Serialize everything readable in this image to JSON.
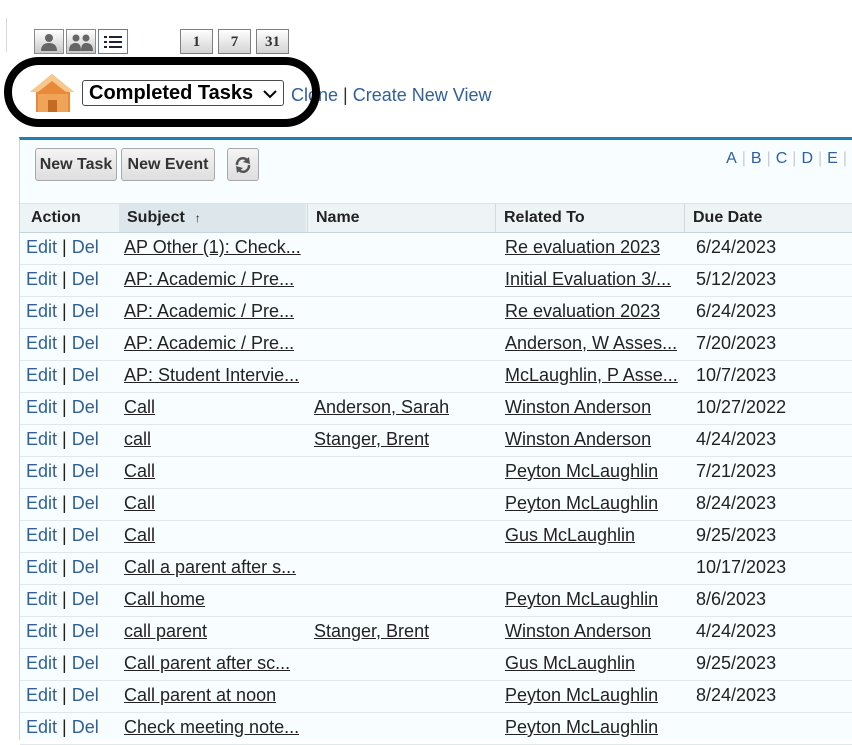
{
  "toolbar": {
    "calendar_buttons": [
      "1",
      "7",
      "31"
    ]
  },
  "view": {
    "selected": "Completed Tasks",
    "clone_label": "Clone",
    "separator": "|",
    "create_label": "Create New View"
  },
  "actions": {
    "new_task": "New Task",
    "new_event": "New Event"
  },
  "alphabet": [
    "A",
    "B",
    "C",
    "D",
    "E"
  ],
  "table": {
    "headers": {
      "action": "Action",
      "subject": "Subject",
      "sort_arrow": "↑",
      "name": "Name",
      "related": "Related To",
      "due": "Due Date"
    },
    "edit_label": "Edit",
    "del_label": "Del",
    "rows": [
      {
        "subject": "AP Other (1): Check...",
        "name": "",
        "related": "Re evaluation 2023",
        "due": "6/24/2023"
      },
      {
        "subject": "AP: Academic / Pre...",
        "name": "",
        "related": "Initial Evaluation 3/...",
        "due": "5/12/2023"
      },
      {
        "subject": "AP: Academic / Pre...",
        "name": "",
        "related": "Re evaluation 2023",
        "due": "6/24/2023"
      },
      {
        "subject": "AP: Academic / Pre...",
        "name": "",
        "related": "Anderson, W Asses...",
        "due": "7/20/2023"
      },
      {
        "subject": "AP: Student Intervie...",
        "name": "",
        "related": "McLaughlin, P Asse...",
        "due": "10/7/2023"
      },
      {
        "subject": "Call",
        "name": "Anderson, Sarah",
        "related": "Winston Anderson",
        "due": "10/27/2022"
      },
      {
        "subject": "call",
        "name": "Stanger, Brent",
        "related": "Winston Anderson",
        "due": "4/24/2023"
      },
      {
        "subject": "Call",
        "name": "",
        "related": "Peyton McLaughlin",
        "due": "7/21/2023"
      },
      {
        "subject": "Call",
        "name": "",
        "related": "Peyton McLaughlin",
        "due": "8/24/2023"
      },
      {
        "subject": "Call",
        "name": "",
        "related": "Gus McLaughlin",
        "due": "9/25/2023"
      },
      {
        "subject": "Call a parent after s...",
        "name": "",
        "related": "",
        "due": "10/17/2023"
      },
      {
        "subject": "Call home",
        "name": "",
        "related": "Peyton McLaughlin",
        "due": "8/6/2023"
      },
      {
        "subject": "call parent",
        "name": "Stanger, Brent",
        "related": "Winston Anderson",
        "due": "4/24/2023"
      },
      {
        "subject": "Call parent after sc...",
        "name": "",
        "related": "Gus McLaughlin",
        "due": "9/25/2023"
      },
      {
        "subject": "Call parent at noon",
        "name": "",
        "related": "Peyton McLaughlin",
        "due": "8/24/2023"
      },
      {
        "subject": "Check meeting note...",
        "name": "",
        "related": "Peyton McLaughlin",
        "due": ""
      }
    ]
  },
  "colors": {
    "link": "#2f5f9e",
    "panel_accent": "#1f7fb1",
    "annotation": "#000000"
  },
  "icons": [
    "single-user-icon",
    "multi-user-icon",
    "list-view-icon",
    "home-icon",
    "refresh-icon",
    "chevron-down-icon",
    "sort-ascending-icon"
  ]
}
